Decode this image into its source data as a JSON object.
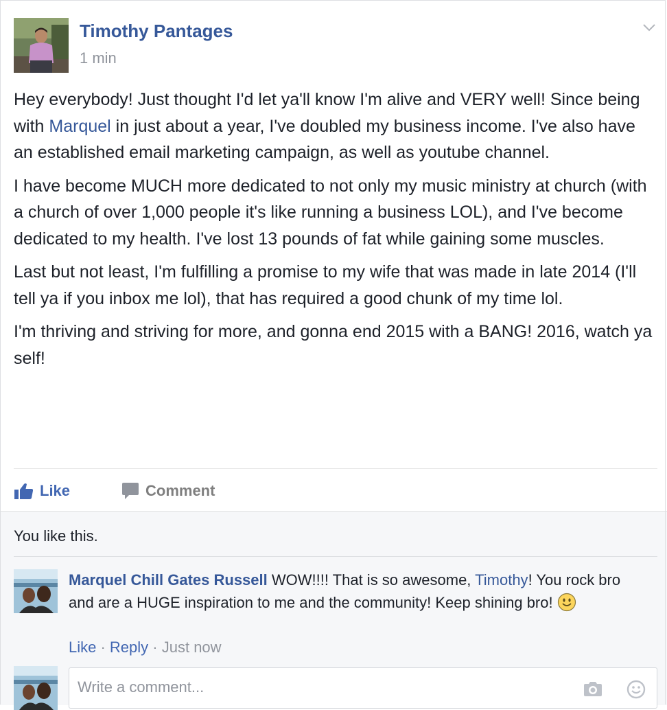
{
  "post": {
    "author": "Timothy Pantages",
    "timestamp": "1 min",
    "paragraphs": [
      {
        "before": "Hey everybody! Just thought I'd let ya'll know I'm alive and VERY well! Since being with ",
        "mention": "Marquel",
        "after": " in just about a year, I've doubled my business income. I've also have an established email marketing campaign, as well as youtube channel."
      },
      {
        "text": "I have become MUCH more dedicated to not only my music ministry at church (with a church of over 1,000 people it's like running a business LOL), and I've become dedicated to my health. I've lost 13 pounds of fat while gaining some muscles."
      },
      {
        "text": "Last but not least, I'm fulfilling a promise to my wife that was made in late 2014 (I'll tell ya if you inbox me lol), that has required a good chunk of my time lol."
      },
      {
        "text": "I'm thriving and striving for more, and gonna end 2015 with a BANG! 2016, watch ya self!"
      }
    ]
  },
  "actions": {
    "like_label": "Like",
    "comment_label": "Comment"
  },
  "likes_summary": "You like this.",
  "comment": {
    "author": "Marquel Chill Gates Russell",
    "text_before": " WOW!!!! That is so awesome, ",
    "mention": "Timothy",
    "text_after": "! You rock bro and are a HUGE inspiration to me and the community! Keep shining bro! ",
    "like_label": "Like",
    "reply_label": "Reply",
    "separator": " · ",
    "time": "Just now"
  },
  "composer": {
    "placeholder": "Write a comment..."
  },
  "icons": {
    "chevron": "chevron-down-icon",
    "like": "thumbs-up-icon",
    "comment": "speech-bubble-icon",
    "smiley": "smiley-emoji-icon",
    "camera": "camera-icon",
    "emoji": "emoji-icon"
  },
  "colors": {
    "link_blue": "#365899",
    "action_blue": "#4267b2",
    "meta_gray": "#90949c",
    "comments_bg": "#f6f7f9"
  }
}
